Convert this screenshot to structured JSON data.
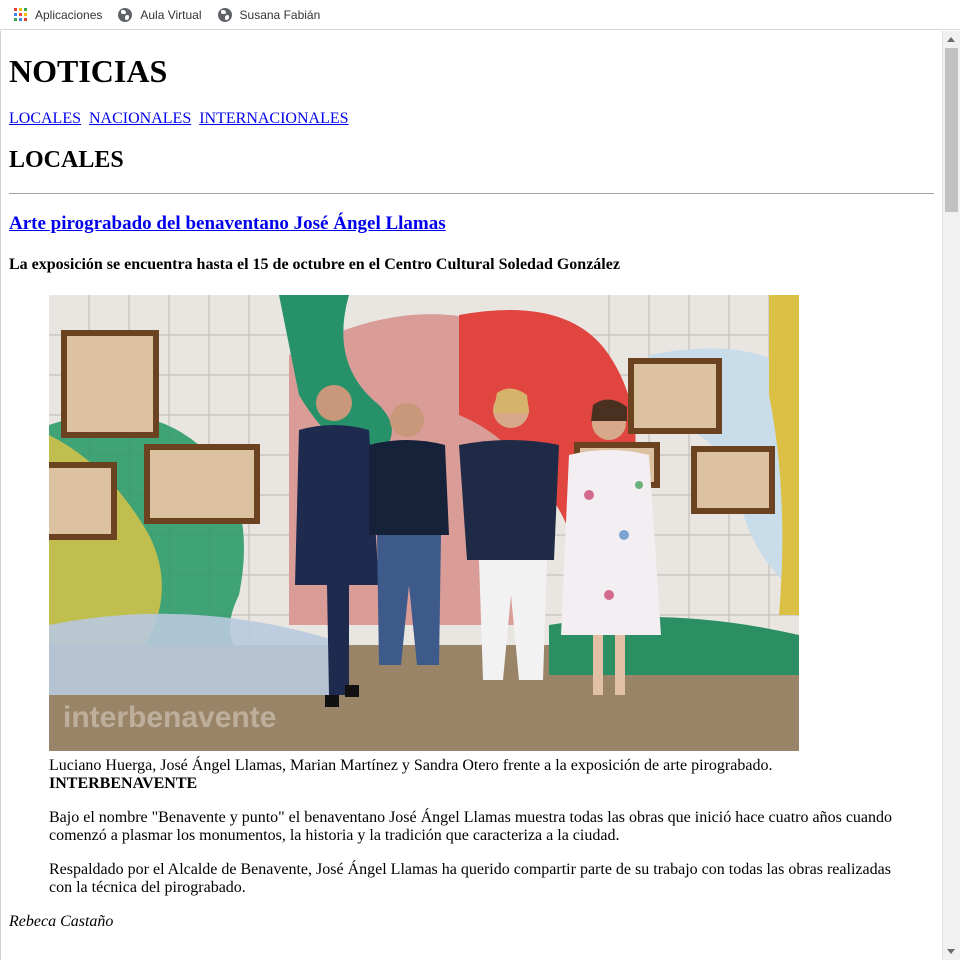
{
  "bookmarks": {
    "items": [
      {
        "label": "Aplicaciones",
        "icon": "apps-grid-icon"
      },
      {
        "label": "Aula Virtual",
        "icon": "globe-icon"
      },
      {
        "label": "Susana Fabián",
        "icon": "globe-icon"
      }
    ]
  },
  "page": {
    "heading": "NOTICIAS",
    "nav": [
      "LOCALES",
      "NACIONALES",
      "INTERNACIONALES"
    ],
    "section_title": "LOCALES",
    "article": {
      "title": "Arte pirograbado del benaventano José Ángel Llamas",
      "subtitle": "La exposición se encuentra hasta el 15 de octubre en el Centro Cultural Soledad González",
      "caption": "Luciano Huerga, José Ángel Llamas, Marian Martínez y Sandra Otero frente a la exposición de arte pirograbado.",
      "caption_credit": "INTERBENAVENTE",
      "paragraph_1": "Bajo el nombre \"Benavente y punto\" el benaventano José Ángel Llamas muestra todas las obras que inició hace cuatro años cuando comenzó a plasmar los monumentos, la historia y la tradición que caracteriza a la ciudad.",
      "paragraph_2": "Respaldado por el Alcalde de Benavente, José Ángel Llamas ha querido compartir parte de su trabajo con todas las obras realizadas con la técnica del pirograbado.",
      "author": "Rebeca Castaño",
      "watermark": "interbenavente"
    }
  },
  "colors": {
    "link": "#0000ee",
    "scroll_thumb": "#c1c1c1"
  }
}
